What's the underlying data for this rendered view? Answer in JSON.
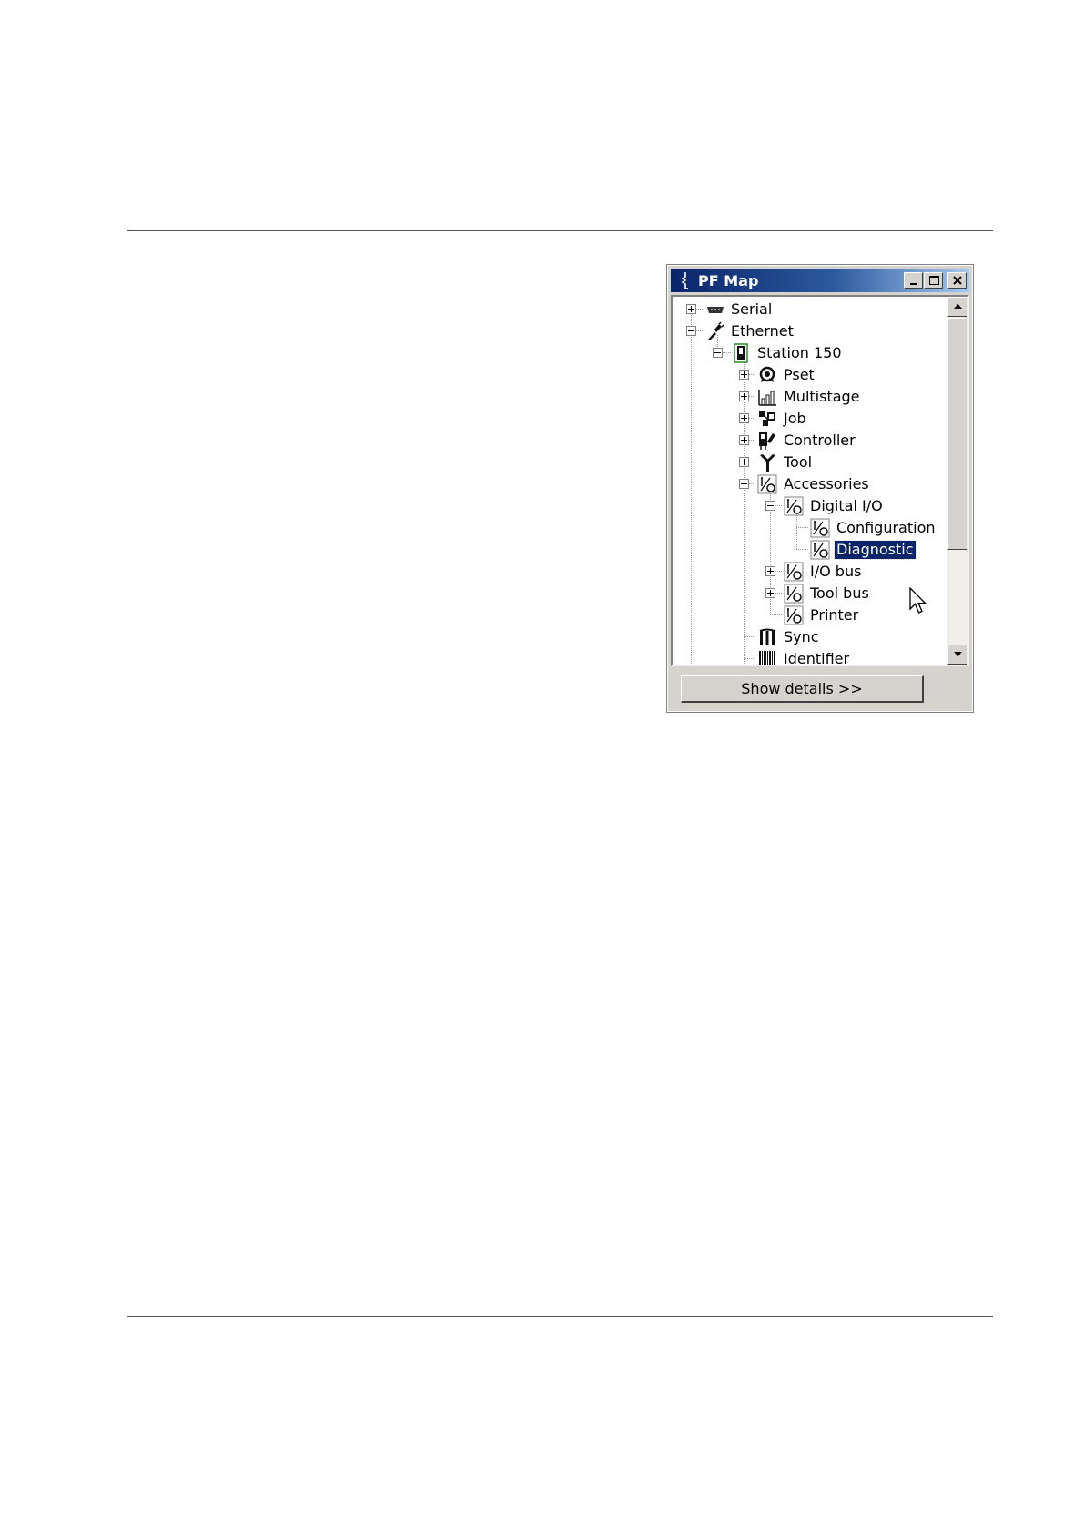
{
  "window": {
    "title": "PF Map"
  },
  "tree": [
    {
      "label": "Serial",
      "icon": "serial-port-icon",
      "expander": "plus"
    },
    {
      "label": "Ethernet",
      "icon": "ethernet-icon",
      "expander": "minus"
    },
    {
      "label": "Station 150",
      "icon": "station-icon",
      "expander": "minus"
    },
    {
      "label": "Pset",
      "icon": "pset-icon",
      "expander": "plus"
    },
    {
      "label": "Multistage",
      "icon": "multistage-icon",
      "expander": "plus"
    },
    {
      "label": "Job",
      "icon": "job-icon",
      "expander": "plus"
    },
    {
      "label": "Controller",
      "icon": "controller-icon",
      "expander": "plus"
    },
    {
      "label": "Tool",
      "icon": "tool-icon",
      "expander": "plus"
    },
    {
      "label": "Accessories",
      "icon": "io-icon",
      "expander": "minus"
    },
    {
      "label": "Digital I/O",
      "icon": "io-icon",
      "expander": "minus"
    },
    {
      "label": "Configuration",
      "icon": "io-icon",
      "expander": "none"
    },
    {
      "label": "Diagnostic",
      "icon": "io-icon",
      "expander": "none",
      "selected": true
    },
    {
      "label": "I/O bus",
      "icon": "io-icon",
      "expander": "plus"
    },
    {
      "label": "Tool bus",
      "icon": "io-icon",
      "expander": "plus"
    },
    {
      "label": "Printer",
      "icon": "io-icon",
      "expander": "none"
    },
    {
      "label": "Sync",
      "icon": "sync-icon",
      "expander": "none"
    },
    {
      "label": "Identifier",
      "icon": "barcode-icon",
      "expander": "none"
    }
  ],
  "details_button": {
    "label": "Show details >>"
  }
}
